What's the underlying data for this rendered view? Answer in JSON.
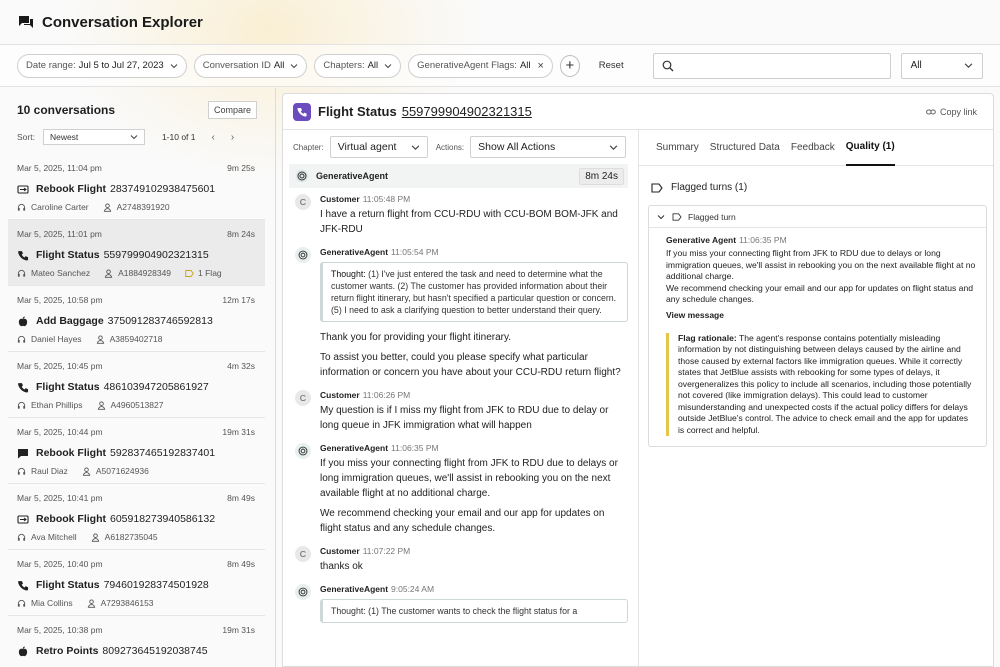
{
  "app": {
    "title": "Conversation Explorer"
  },
  "filters": {
    "date_label": "Date range:",
    "date_value": "Jul 5 to Jul 27, 2023",
    "convid_label": "Conversation ID",
    "convid_value": "All",
    "chapters_label": "Chapters:",
    "chapters_value": "All",
    "ga_label": "GenerativeAgent Flags:",
    "ga_value": "All",
    "reset": "Reset",
    "search_placeholder": "",
    "all_value": "All"
  },
  "left": {
    "count": "10 conversations",
    "compare": "Compare",
    "sort_label": "Sort:",
    "sort_value": "Newest",
    "pager": "1-10 of 1",
    "items": [
      {
        "date": "Mar 5, 2025, 11:04 pm",
        "dur": "9m 25s",
        "type": "Rebook Flight",
        "id": "283749102938475601",
        "agent": "Caroline Carter",
        "acct": "A2748391920",
        "flag": ""
      },
      {
        "date": "Mar 5, 2025, 11:01 pm",
        "dur": "8m 24s",
        "type": "Flight Status",
        "id": "559799904902321315",
        "agent": "Mateo Sanchez",
        "acct": "A1884928349",
        "flag": "1 Flag"
      },
      {
        "date": "Mar 5, 2025, 10:58 pm",
        "dur": "12m 17s",
        "type": "Add Baggage",
        "id": "375091283746592813",
        "agent": "Daniel Hayes",
        "acct": "A3859402718",
        "flag": ""
      },
      {
        "date": "Mar 5, 2025, 10:45 pm",
        "dur": "4m 32s",
        "type": "Flight Status",
        "id": "486103947205861927",
        "agent": "Ethan Phillips",
        "acct": "A4960513827",
        "flag": ""
      },
      {
        "date": "Mar 5, 2025, 10:44 pm",
        "dur": "19m 31s",
        "type": "Rebook Flight",
        "id": "592837465192837401",
        "agent": "Raul Diaz",
        "acct": "A5071624936",
        "flag": ""
      },
      {
        "date": "Mar 5, 2025, 10:41 pm",
        "dur": "8m 49s",
        "type": "Rebook Flight",
        "id": "605918273940586132",
        "agent": "Ava Mitchell",
        "acct": "A6182735045",
        "flag": ""
      },
      {
        "date": "Mar 5, 2025, 10:40 pm",
        "dur": "8m 49s",
        "type": "Flight Status",
        "id": "794601928374501928",
        "agent": "Mia Collins",
        "acct": "A7293846153",
        "flag": ""
      },
      {
        "date": "Mar 5, 2025, 10:38 pm",
        "dur": "19m 31s",
        "type": "Retro Points",
        "id": "809273645192038745",
        "agent": "",
        "acct": "",
        "flag": ""
      }
    ]
  },
  "detail": {
    "title": "Flight Status",
    "id": "559799904902321315",
    "copy_link": "Copy link",
    "chapter_label": "Chapter:",
    "chapter_value": "Virtual agent",
    "actions_label": "Actions:",
    "actions_value": "Show All Actions",
    "agent_bar_name": "GenerativeAgent",
    "agent_bar_dur": "8m 24s",
    "messages": {
      "m1_author": "Customer",
      "m1_time": "11:05:48 PM",
      "m1_text": "I have a return flight from CCU-RDU with CCU-BOM BOM-JFK and JFK-RDU",
      "m2_author": "GenerativeAgent",
      "m2_time": "11:05:54 PM",
      "m2_thought_label": "Thought:",
      "m2_thought": " (1) I've just entered the task and need to determine what the customer wants. (2) The customer has provided information about their return flight itinerary, but hasn't specified a particular question or concern. (5) I need to ask a clarifying question to better understand their query.",
      "m2_p1": "Thank you for providing your flight itinerary.",
      "m2_p2": "To assist you better, could you please specify what particular information or concern you have about your CCU-RDU return flight?",
      "m3_author": "Customer",
      "m3_time": "11:06:26 PM",
      "m3_text": "My question is if I miss my flight from JFK to RDU due to delay or long queue in JFK immigration what will happen",
      "m4_author": "GenerativeAgent",
      "m4_time": "11:06:35 PM",
      "m4_p1": "If you miss your connecting flight from JFK to RDU due to delays or long immigration queues, we'll assist in rebooking you on the next available flight at no additional charge.",
      "m4_p2": "We recommend checking your email and our app for updates on flight status and any schedule changes.",
      "m5_author": "Customer",
      "m5_time": "11:07:22 PM",
      "m5_text": "thanks ok",
      "m6_author": "GenerativeAgent",
      "m6_time": "9:05:24 AM",
      "m6_thought": "Thought: (1) The customer wants to check the flight status for a"
    }
  },
  "quality": {
    "tabs": [
      "Summary",
      "Structured Data",
      "Feedback",
      "Quality (1)"
    ],
    "flagged_heading": "Flagged turns (1)",
    "flagged_turn": "Flagged turn",
    "author": "Generative Agent",
    "time": "11:06:35 PM",
    "p1": "If you miss your connecting flight from JFK to RDU due to delays or long immigration queues, we'll assist in rebooking you on the next available flight at no additional charge.",
    "p2": "We recommend checking your email and our app for updates on flight status and any schedule changes.",
    "view_message": "View message",
    "rationale_label": "Flag rationale:",
    "rationale": " The agent's response contains potentially misleading information by not distinguishing between delays caused by the airline and those caused by external factors like immigration queues. While it correctly states that JetBlue assists with rebooking for some types of delays, it overgeneralizes this policy to include all scenarios, including those potentially not covered (like immigration delays). This could lead to customer misunderstanding and unexpected costs if the actual policy differs for delays outside JetBlue's control. The advice to check email and the app for updates is correct and helpful."
  }
}
